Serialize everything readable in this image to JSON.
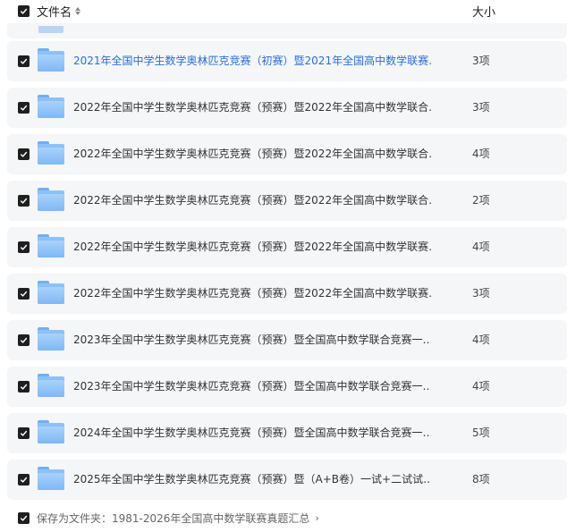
{
  "header": {
    "name_label": "文件名",
    "size_label": "大小"
  },
  "files": [
    {
      "name": "2021年全国中学生数学奥林匹克竞赛（初赛）暨2021年全国高中数学联赛…",
      "size": "3项",
      "active": true
    },
    {
      "name": "2022年全国中学生数学奥林匹克竞赛（预赛）暨2022年全国高中数学联合…",
      "size": "3项",
      "active": false
    },
    {
      "name": "2022年全国中学生数学奥林匹克竞赛（预赛）暨2022年全国高中数学联合…",
      "size": "4项",
      "active": false
    },
    {
      "name": "2022年全国中学生数学奥林匹克竞赛（预赛）暨2022年全国高中数学联合…",
      "size": "2项",
      "active": false
    },
    {
      "name": "2022年全国中学生数学奥林匹克竞赛（预赛）暨2022年全国高中数学联赛…",
      "size": "4项",
      "active": false
    },
    {
      "name": "2022年全国中学生数学奥林匹克竞赛（预赛）暨2022年全国高中数学联赛…",
      "size": "3项",
      "active": false
    },
    {
      "name": "2023年全国中学生数学奥林匹克竞赛（预赛）暨全国高中数学联合竞赛一…",
      "size": "4项",
      "active": false
    },
    {
      "name": "2023年全国中学生数学奥林匹克竞赛（预赛）暨全国高中数学联合竞赛一…",
      "size": "4项",
      "active": false
    },
    {
      "name": "2024年全国中学生数学奥林匹克竞赛（预赛）暨全国高中数学联合竞赛一…",
      "size": "5项",
      "active": false
    },
    {
      "name": "2025年全国中学生数学奥林匹克竞赛（预赛）暨（A+B卷）一试+二试试…",
      "size": "8项",
      "active": false
    }
  ],
  "footer": {
    "save_label": "保存为文件夹：",
    "folder_name": "1981-2026年全国高中数学联赛真题汇总"
  }
}
